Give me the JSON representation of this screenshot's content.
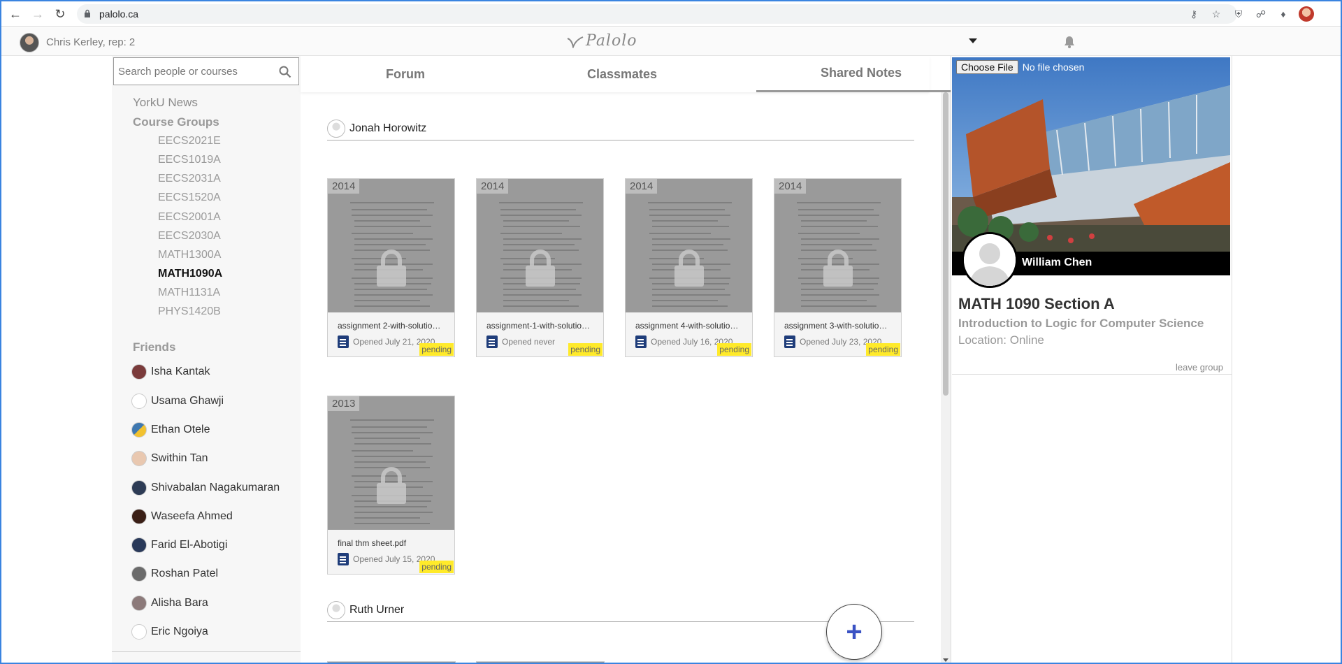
{
  "browser": {
    "url": "palolo.ca"
  },
  "app": {
    "user_label": "Chris Kerley, rep: 2",
    "logo": "Palolo"
  },
  "search": {
    "placeholder": "Search people or courses"
  },
  "sidebar": {
    "news": "YorkU News",
    "groups_heading": "Course Groups",
    "courses": [
      {
        "label": "EECS2021E",
        "active": false
      },
      {
        "label": "EECS1019A",
        "active": false
      },
      {
        "label": "EECS2031A",
        "active": false
      },
      {
        "label": "EECS1520A",
        "active": false
      },
      {
        "label": "EECS2001A",
        "active": false
      },
      {
        "label": "EECS2030A",
        "active": false
      },
      {
        "label": "MATH1300A",
        "active": false
      },
      {
        "label": "MATH1090A",
        "active": true
      },
      {
        "label": "MATH1131A",
        "active": false
      },
      {
        "label": "PHYS1420B",
        "active": false
      }
    ],
    "friends_heading": "Friends",
    "friends": [
      {
        "name": "Isha Kantak",
        "avatar_color": "#7a3b3b"
      },
      {
        "name": "Usama Ghawji",
        "avatar_color": "#ffffff"
      },
      {
        "name": "Ethan Otele",
        "avatar_color": "#3f78b0"
      },
      {
        "name": "Swithin Tan",
        "avatar_color": "#e9c8b0"
      },
      {
        "name": "Shivabalan Nagakumaran",
        "avatar_color": "#2d3b55"
      },
      {
        "name": "Waseefa Ahmed",
        "avatar_color": "#3a1f16"
      },
      {
        "name": "Farid El-Abotigi",
        "avatar_color": "#2a3a5a"
      },
      {
        "name": "Roshan Patel",
        "avatar_color": "#6b6b6b"
      },
      {
        "name": "Alisha Bara",
        "avatar_color": "#8c7a7a"
      },
      {
        "name": "Eric Ngoiya",
        "avatar_color": "#ffffff"
      }
    ]
  },
  "tabs": [
    {
      "label": "Forum",
      "active": false
    },
    {
      "label": "Classmates",
      "active": false
    },
    {
      "label": "Shared Notes",
      "active": true
    }
  ],
  "notes": {
    "owners": [
      "Jonah Horowitz",
      "Ruth Urner"
    ],
    "cards": [
      {
        "year": "2014",
        "file": "assignment 2-with-solutio…",
        "opened": "Opened July 21, 2020",
        "status": "pending"
      },
      {
        "year": "2014",
        "file": "assignment-1-with-solutio…",
        "opened": "Opened never",
        "status": "pending"
      },
      {
        "year": "2014",
        "file": "assignment 4-with-solutio…",
        "opened": "Opened July 16, 2020",
        "status": "pending"
      },
      {
        "year": "2014",
        "file": "assignment 3-with-solutio…",
        "opened": "Opened July 23, 2020",
        "status": "pending"
      },
      {
        "year": "2013",
        "file": "final thm sheet.pdf",
        "opened": "Opened July 15, 2020",
        "status": "pending"
      }
    ],
    "fab_label": "+"
  },
  "group": {
    "file_button": "Choose File",
    "file_status": "No file chosen",
    "professor": "William Chen",
    "title": "MATH 1090 Section A",
    "description": "Introduction to Logic for Computer Science",
    "location": "Location: Online",
    "leave": "leave group"
  },
  "colors": {
    "pending": "#ffea2a",
    "fab_plus": "#3a52c4",
    "doc_icon": "#1f3d7a"
  }
}
